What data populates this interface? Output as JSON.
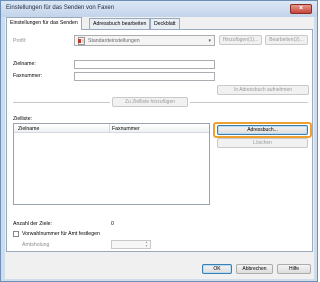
{
  "window": {
    "title": "Einstellungen für das Senden von Faxen",
    "close_glyph": "×"
  },
  "tabs": [
    {
      "label": "Einstellungen für das Senden"
    },
    {
      "label": "Adressbuch bearbeiten"
    },
    {
      "label": "Deckblatt"
    }
  ],
  "profile": {
    "label": "Profil:",
    "value": "Standardeinstellungen",
    "add_button": "Hinzufügen(1)...",
    "edit_button": "Bearbeiten(2)..."
  },
  "target": {
    "name_label": "Zielname:",
    "number_label": "Faxnummer:",
    "name_value": "",
    "number_value": "",
    "register_button": "In Adressbuch aufnehmen",
    "add_to_list_button": "Zu Zielliste hinzufügen"
  },
  "dest_list": {
    "label": "Zielliste:",
    "columns": [
      "Zielname",
      "Faxnummer"
    ],
    "address_book_button": "Adressbuch...",
    "delete_button": "Löschen"
  },
  "count": {
    "label": "Anzahl der Ziele:",
    "value": "0"
  },
  "prefix": {
    "checkbox_label": "Vorwahlnummer für Amt festlegen",
    "sub_label": "Amtsholung"
  },
  "footer": {
    "ok": "OK",
    "cancel": "Abbrechen",
    "help": "Hilfe"
  },
  "colors": {
    "highlight": "#f0a030",
    "title_bar": "#c3d4ea",
    "close_button": "#c7443a"
  }
}
